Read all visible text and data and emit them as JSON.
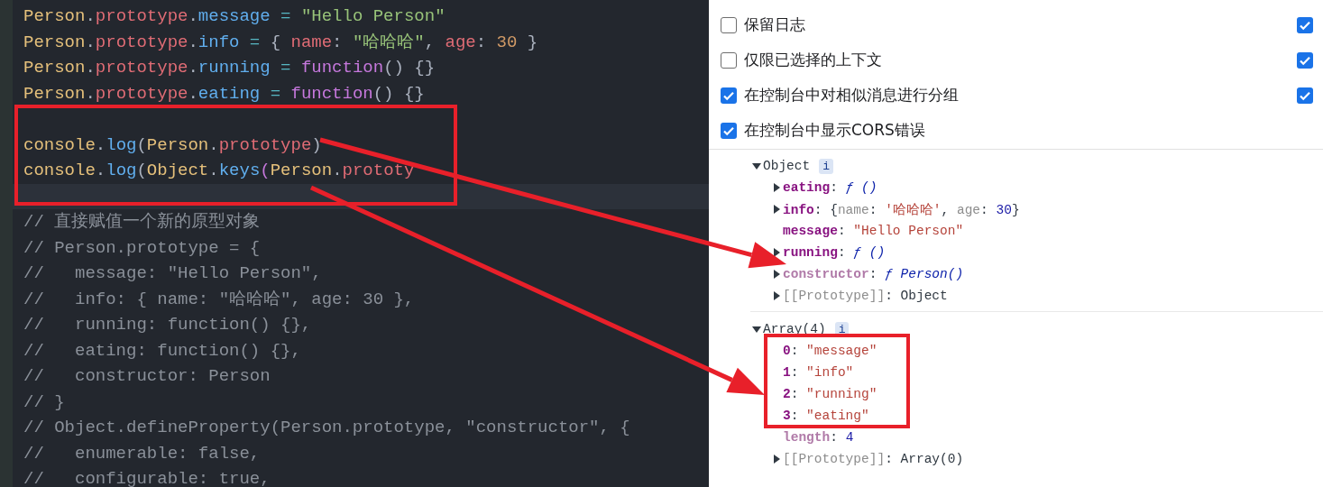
{
  "editor": {
    "lines": [
      {
        "current": false,
        "tokens": [
          {
            "kind": "ident",
            "text": "Person"
          },
          {
            "kind": "punct",
            "text": "."
          },
          {
            "kind": "prop",
            "text": "prototype"
          },
          {
            "kind": "punct",
            "text": "."
          },
          {
            "kind": "member",
            "text": "message"
          },
          {
            "kind": "op",
            "text": " = "
          },
          {
            "kind": "str",
            "text": "\"Hello Person\""
          }
        ]
      },
      {
        "current": false,
        "tokens": [
          {
            "kind": "ident",
            "text": "Person"
          },
          {
            "kind": "punct",
            "text": "."
          },
          {
            "kind": "prop",
            "text": "prototype"
          },
          {
            "kind": "punct",
            "text": "."
          },
          {
            "kind": "member",
            "text": "info"
          },
          {
            "kind": "op",
            "text": " = "
          },
          {
            "kind": "punct",
            "text": "{ "
          },
          {
            "kind": "prop",
            "text": "name"
          },
          {
            "kind": "punct",
            "text": ": "
          },
          {
            "kind": "str",
            "text": "\"哈哈哈\""
          },
          {
            "kind": "punct",
            "text": ", "
          },
          {
            "kind": "prop",
            "text": "age"
          },
          {
            "kind": "punct",
            "text": ": "
          },
          {
            "kind": "num",
            "text": "30"
          },
          {
            "kind": "punct",
            "text": " }"
          }
        ]
      },
      {
        "current": false,
        "tokens": [
          {
            "kind": "ident",
            "text": "Person"
          },
          {
            "kind": "punct",
            "text": "."
          },
          {
            "kind": "prop",
            "text": "prototype"
          },
          {
            "kind": "punct",
            "text": "."
          },
          {
            "kind": "member",
            "text": "running"
          },
          {
            "kind": "op",
            "text": " = "
          },
          {
            "kind": "kw",
            "text": "function"
          },
          {
            "kind": "punct",
            "text": "() {}"
          }
        ]
      },
      {
        "current": false,
        "tokens": [
          {
            "kind": "ident",
            "text": "Person"
          },
          {
            "kind": "punct",
            "text": "."
          },
          {
            "kind": "prop",
            "text": "prototype"
          },
          {
            "kind": "punct",
            "text": "."
          },
          {
            "kind": "member",
            "text": "eating"
          },
          {
            "kind": "op",
            "text": " = "
          },
          {
            "kind": "kw",
            "text": "function"
          },
          {
            "kind": "punct",
            "text": "() {}"
          }
        ]
      },
      {
        "current": false
      },
      {
        "current": false,
        "tokens": [
          {
            "kind": "ident",
            "text": "console"
          },
          {
            "kind": "punct",
            "text": "."
          },
          {
            "kind": "member",
            "text": "log"
          },
          {
            "kind": "punct",
            "text": "("
          },
          {
            "kind": "ident",
            "text": "Person"
          },
          {
            "kind": "punct",
            "text": "."
          },
          {
            "kind": "prop",
            "text": "prototype"
          },
          {
            "kind": "punct",
            "text": ")"
          }
        ]
      },
      {
        "current": false,
        "tokens": [
          {
            "kind": "ident",
            "text": "console"
          },
          {
            "kind": "punct",
            "text": "."
          },
          {
            "kind": "member",
            "text": "log"
          },
          {
            "kind": "punct",
            "text": "("
          },
          {
            "kind": "ident",
            "text": "Object"
          },
          {
            "kind": "punct",
            "text": "."
          },
          {
            "kind": "member",
            "text": "keys"
          },
          {
            "kind": "kw",
            "text": "("
          },
          {
            "kind": "ident",
            "text": "Person"
          },
          {
            "kind": "punct",
            "text": "."
          },
          {
            "kind": "prop",
            "text": "prototy"
          }
        ]
      },
      {
        "current": true
      },
      {
        "current": false,
        "tokens": [
          {
            "kind": "comment",
            "text": "// 直接赋值一个新的原型对象"
          }
        ]
      },
      {
        "current": false,
        "tokens": [
          {
            "kind": "comment",
            "text": "// Person.prototype = {"
          }
        ]
      },
      {
        "current": false,
        "tokens": [
          {
            "kind": "comment",
            "text": "//   message: \"Hello Person\","
          }
        ]
      },
      {
        "current": false,
        "tokens": [
          {
            "kind": "comment",
            "text": "//   info: { name: \"哈哈哈\", age: 30 },"
          }
        ]
      },
      {
        "current": false,
        "tokens": [
          {
            "kind": "comment",
            "text": "//   running: function() {},"
          }
        ]
      },
      {
        "current": false,
        "tokens": [
          {
            "kind": "comment",
            "text": "//   eating: function() {},"
          }
        ]
      },
      {
        "current": false,
        "tokens": [
          {
            "kind": "comment",
            "text": "//   constructor: Person"
          }
        ]
      },
      {
        "current": false,
        "tokens": [
          {
            "kind": "comment",
            "text": "// }"
          }
        ]
      },
      {
        "current": false,
        "tokens": [
          {
            "kind": "comment",
            "text": "// Object.defineProperty(Person.prototype, \"constructor\", {"
          }
        ]
      },
      {
        "current": false,
        "tokens": [
          {
            "kind": "comment",
            "text": "//   enumerable: false,"
          }
        ]
      },
      {
        "current": false,
        "tokens": [
          {
            "kind": "comment",
            "text": "//   configurable: true,"
          }
        ]
      }
    ]
  },
  "settings": {
    "options": [
      {
        "label": "保留日志",
        "checked": false
      },
      {
        "label": "仅限已选择的上下文",
        "checked": false
      },
      {
        "label": "在控制台中对相似消息进行分组",
        "checked": true
      },
      {
        "label": "在控制台中显示CORS错误",
        "checked": true
      }
    ],
    "side_options": [
      {
        "checked": true
      },
      {
        "checked": true
      },
      {
        "checked": true
      }
    ]
  },
  "console": {
    "groups": [
      {
        "label": "Object",
        "badge": "i",
        "expanded": true,
        "rows": [
          {
            "expandable": true,
            "parts": [
              {
                "kind": "key",
                "text": "eating"
              },
              {
                "kind": "punct",
                "text": ": "
              },
              {
                "kind": "func",
                "text": "ƒ ()"
              }
            ]
          },
          {
            "expandable": true,
            "parts": [
              {
                "kind": "key",
                "text": "info"
              },
              {
                "kind": "punct",
                "text": ": "
              },
              {
                "kind": "punct",
                "text": "{"
              },
              {
                "kind": "dim",
                "text": "name"
              },
              {
                "kind": "punct",
                "text": ": "
              },
              {
                "kind": "str",
                "text": "'哈哈哈'"
              },
              {
                "kind": "punct",
                "text": ", "
              },
              {
                "kind": "dim",
                "text": "age"
              },
              {
                "kind": "punct",
                "text": ": "
              },
              {
                "kind": "num",
                "text": "30"
              },
              {
                "kind": "punct",
                "text": "}"
              }
            ]
          },
          {
            "expandable": false,
            "parts": [
              {
                "kind": "key",
                "text": "message"
              },
              {
                "kind": "punct",
                "text": ": "
              },
              {
                "kind": "str",
                "text": "\"Hello Person\""
              }
            ]
          },
          {
            "expandable": true,
            "parts": [
              {
                "kind": "key",
                "text": "running"
              },
              {
                "kind": "punct",
                "text": ": "
              },
              {
                "kind": "func",
                "text": "ƒ ()"
              }
            ]
          },
          {
            "expandable": true,
            "parts": [
              {
                "kind": "key-dim",
                "text": "constructor"
              },
              {
                "kind": "punct",
                "text": ": "
              },
              {
                "kind": "func",
                "text": "ƒ Person()"
              }
            ]
          },
          {
            "expandable": true,
            "parts": [
              {
                "kind": "dim",
                "text": "[[Prototype]]"
              },
              {
                "kind": "punct",
                "text": ": "
              },
              {
                "kind": "plain",
                "text": "Object"
              }
            ]
          }
        ]
      },
      {
        "label": "Array(4)",
        "badge": "i",
        "expanded": true,
        "rows": [
          {
            "expandable": false,
            "parts": [
              {
                "kind": "key",
                "text": "0"
              },
              {
                "kind": "punct",
                "text": ": "
              },
              {
                "kind": "str",
                "text": "\"message\""
              }
            ]
          },
          {
            "expandable": false,
            "parts": [
              {
                "kind": "key",
                "text": "1"
              },
              {
                "kind": "punct",
                "text": ": "
              },
              {
                "kind": "str",
                "text": "\"info\""
              }
            ]
          },
          {
            "expandable": false,
            "parts": [
              {
                "kind": "key",
                "text": "2"
              },
              {
                "kind": "punct",
                "text": ": "
              },
              {
                "kind": "str",
                "text": "\"running\""
              }
            ]
          },
          {
            "expandable": false,
            "parts": [
              {
                "kind": "key",
                "text": "3"
              },
              {
                "kind": "punct",
                "text": ": "
              },
              {
                "kind": "str",
                "text": "\"eating\""
              }
            ]
          },
          {
            "expandable": false,
            "parts": [
              {
                "kind": "key-dim",
                "text": "length"
              },
              {
                "kind": "punct",
                "text": ": "
              },
              {
                "kind": "num",
                "text": "4"
              }
            ]
          },
          {
            "expandable": true,
            "parts": [
              {
                "kind": "dim",
                "text": "[[Prototype]]"
              },
              {
                "kind": "punct",
                "text": ": "
              },
              {
                "kind": "plain",
                "text": "Array(0)"
              }
            ]
          }
        ]
      }
    ]
  }
}
